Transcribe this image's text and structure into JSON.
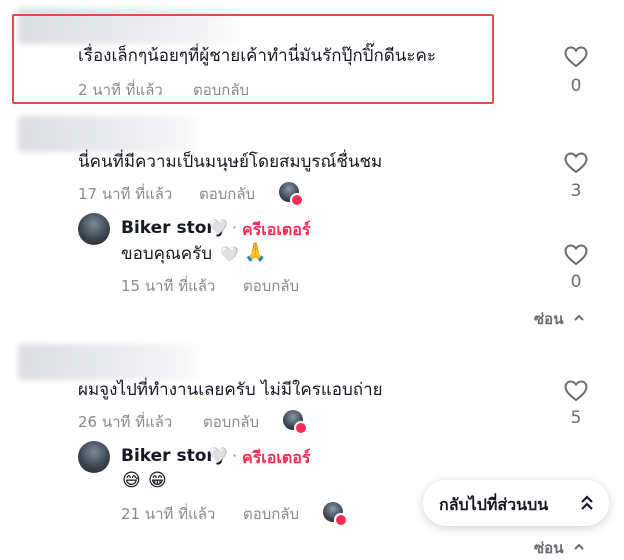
{
  "comments": [
    {
      "text": "เรื่องเล็กๆน้อยๆที่ผู้ชายเค้าทำนี่มันรักปุ๊กปิ๊กดีนะคะ",
      "time": "2 นาที ที่แล้ว",
      "reply_label": "ตอบกลับ",
      "likes": "0"
    },
    {
      "text": "นี่คนที่มีความเป็นมนุษย์โดยสมบูรณ์ชื่นชม",
      "time": "17 นาที ที่แล้ว",
      "reply_label": "ตอบกลับ",
      "likes": "3",
      "reply": {
        "author": "Biker story",
        "separator": "·",
        "creator_label": "ครีเอเตอร์",
        "text": "ขอบคุณครับ",
        "time": "15 นาที ที่แล้ว",
        "reply_label": "ตอบกลับ",
        "likes": "0"
      },
      "hide_label": "ซ่อน"
    },
    {
      "text": "ผมจูงไปที่ทำงานเลยครับ ไม่มีใครแอบถ่าย",
      "time": "26 นาที ที่แล้ว",
      "reply_label": "ตอบกลับ",
      "likes": "5",
      "reply": {
        "author": "Biker story",
        "separator": "·",
        "creator_label": "ครีเอเตอร์",
        "text": "",
        "time": "21 นาที ที่แล้ว",
        "reply_label": "ตอบกลับ"
      },
      "hide_label": "ซ่อน"
    }
  ],
  "back_to_top": "กลับไปที่ส่วนบน",
  "colors": {
    "creator": "#fe2c55",
    "highlight": "#e5484d",
    "meta": "#8a8b91"
  },
  "icons": [
    "heart-outline-icon",
    "chevron-up-icon",
    "double-chevron-up-icon",
    "white-heart-emoji",
    "praying-hands-emoji",
    "grinning-sweat-emoji",
    "grinning-emoji"
  ]
}
